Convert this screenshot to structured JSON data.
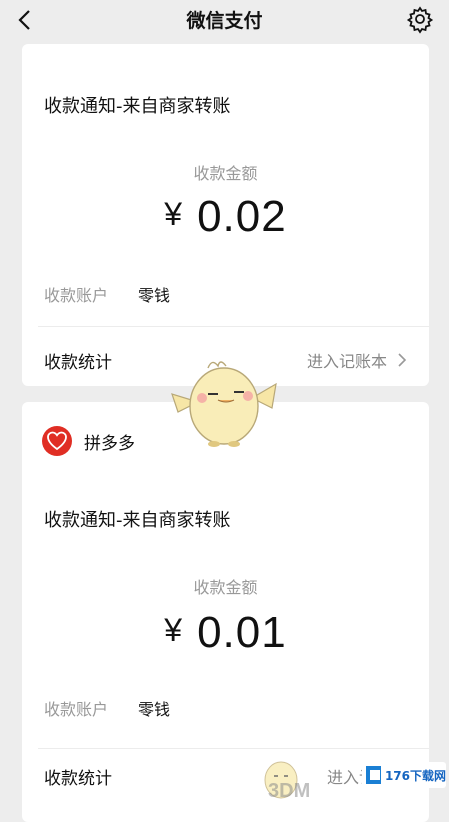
{
  "header": {
    "title": "微信支付",
    "back_icon": "chevron-left-icon",
    "settings_icon": "gear-icon"
  },
  "cards": [
    {
      "notice_title": "收款通知-来自商家转账",
      "amount_label": "收款金额",
      "currency_symbol": "¥",
      "amount": "0.02",
      "account_label": "收款账户",
      "account_value": "零钱",
      "stats_label": "收款统计",
      "stats_link": "进入记账本"
    },
    {
      "merchant_name": "拼多多",
      "notice_title": "收款通知-来自商家转账",
      "amount_label": "收款金额",
      "currency_symbol": "¥",
      "amount": "0.01",
      "account_label": "收款账户",
      "account_value": "零钱",
      "stats_label": "收款统计",
      "stats_link": "进入记账本"
    }
  ],
  "watermark": {
    "text": "3DM",
    "badge_text": "176下载网"
  },
  "colors": {
    "background": "#ededed",
    "card": "#ffffff",
    "merchant_red": "#e02e24",
    "muted_text": "#999999"
  }
}
